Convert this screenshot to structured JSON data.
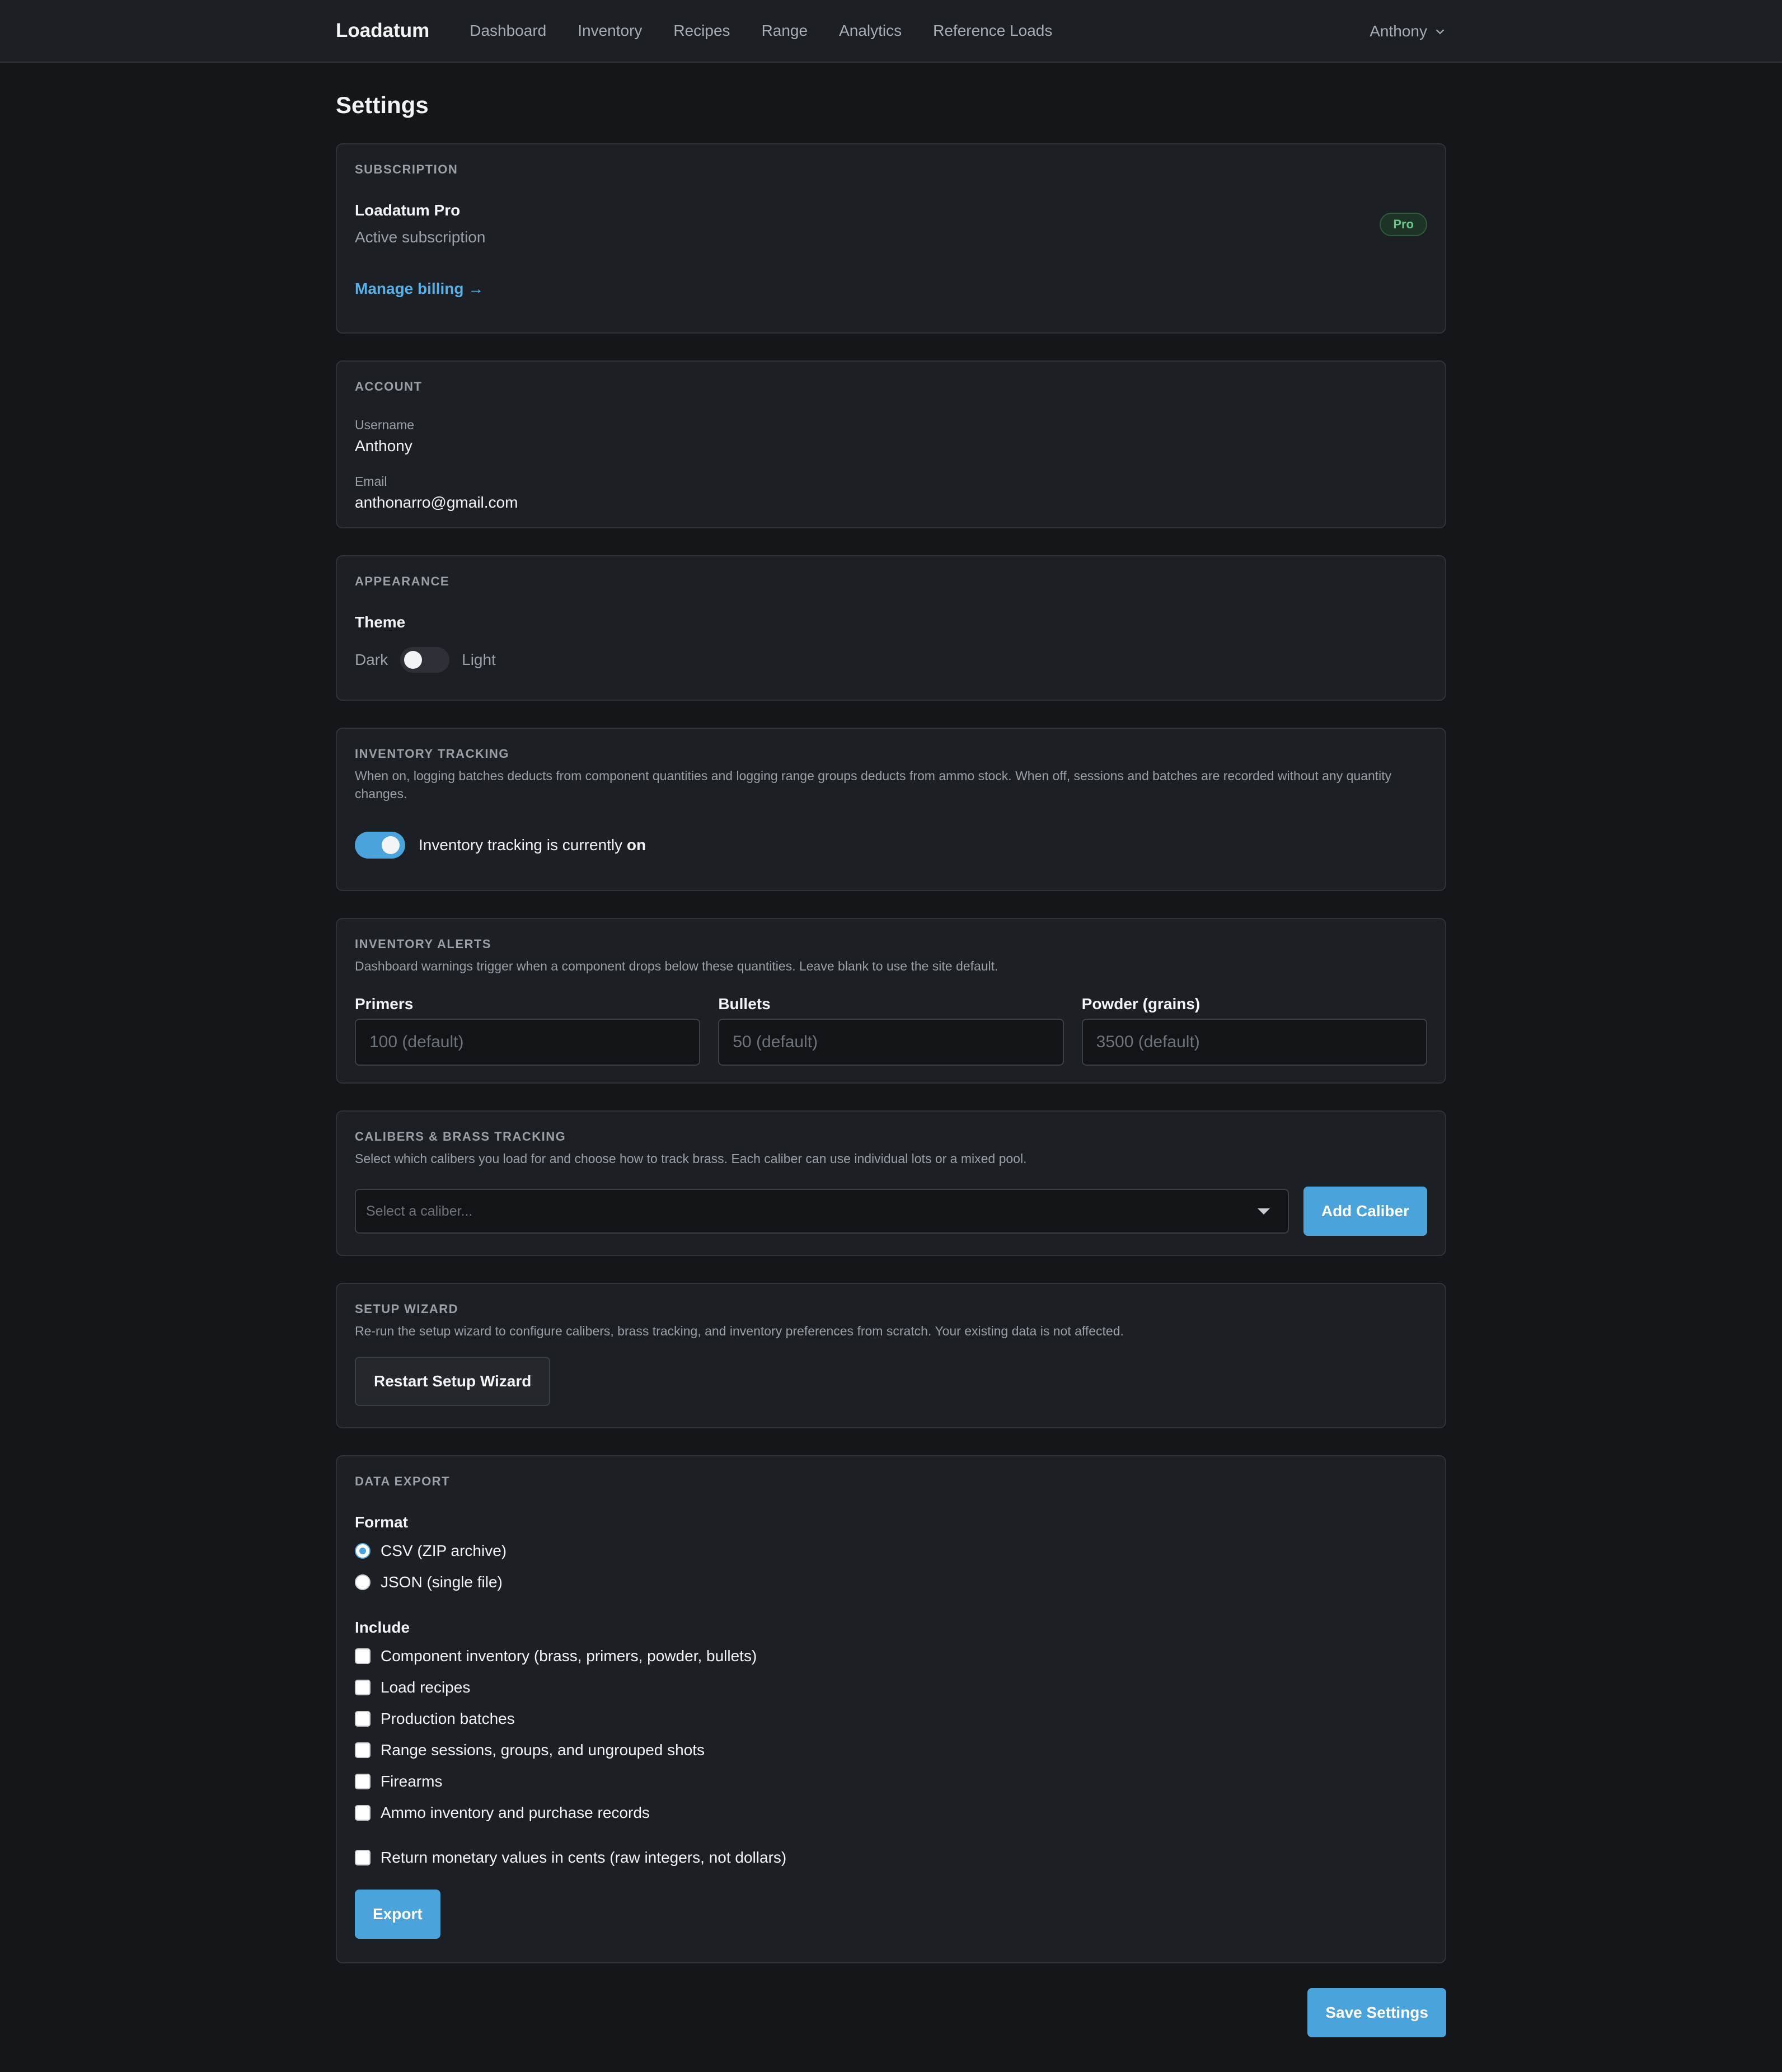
{
  "nav": {
    "brand": "Loadatum",
    "links": [
      "Dashboard",
      "Inventory",
      "Recipes",
      "Range",
      "Analytics",
      "Reference Loads"
    ],
    "user": "Anthony"
  },
  "page_title": "Settings",
  "subscription": {
    "label": "Subscription",
    "plan": "Loadatum Pro",
    "status": "Active subscription",
    "badge": "Pro",
    "manage": "Manage billing →"
  },
  "account": {
    "label": "Account",
    "username_label": "Username",
    "username": "Anthony",
    "email_label": "Email",
    "email": "anthonarro@gmail.com"
  },
  "appearance": {
    "label": "Appearance",
    "theme_title": "Theme",
    "dark": "Dark",
    "light": "Light"
  },
  "inventory_tracking": {
    "label": "Inventory Tracking",
    "desc": "When on, logging batches deducts from component quantities and logging range groups deducts from ammo stock. When off, sessions and batches are recorded without any quantity changes.",
    "status_prefix": "Inventory tracking is currently ",
    "status_value": "on"
  },
  "inventory_alerts": {
    "label": "Inventory Alerts",
    "desc": "Dashboard warnings trigger when a component drops below these quantities. Leave blank to use the site default.",
    "fields": [
      {
        "label": "Primers",
        "placeholder": "100 (default)"
      },
      {
        "label": "Bullets",
        "placeholder": "50 (default)"
      },
      {
        "label": "Powder (grains)",
        "placeholder": "3500 (default)"
      }
    ]
  },
  "calibers": {
    "label": "Calibers & Brass Tracking",
    "desc": "Select which calibers you load for and choose how to track brass. Each caliber can use individual lots or a mixed pool.",
    "select_placeholder": "Select a caliber...",
    "add_button": "Add Caliber"
  },
  "setup_wizard": {
    "label": "Setup Wizard",
    "desc": "Re-run the setup wizard to configure calibers, brass tracking, and inventory preferences from scratch. Your existing data is not affected.",
    "button": "Restart Setup Wizard"
  },
  "data_export": {
    "label": "Data Export",
    "format_title": "Format",
    "formats": [
      "CSV (ZIP archive)",
      "JSON (single file)"
    ],
    "include_title": "Include",
    "includes": [
      "Component inventory (brass, primers, powder, bullets)",
      "Load recipes",
      "Production batches",
      "Range sessions, groups, and ungrouped shots",
      "Firearms",
      "Ammo inventory and purchase records"
    ],
    "cents_option": "Return monetary values in cents (raw integers, not dollars)",
    "export_button": "Export"
  },
  "save_button": "Save Settings"
}
